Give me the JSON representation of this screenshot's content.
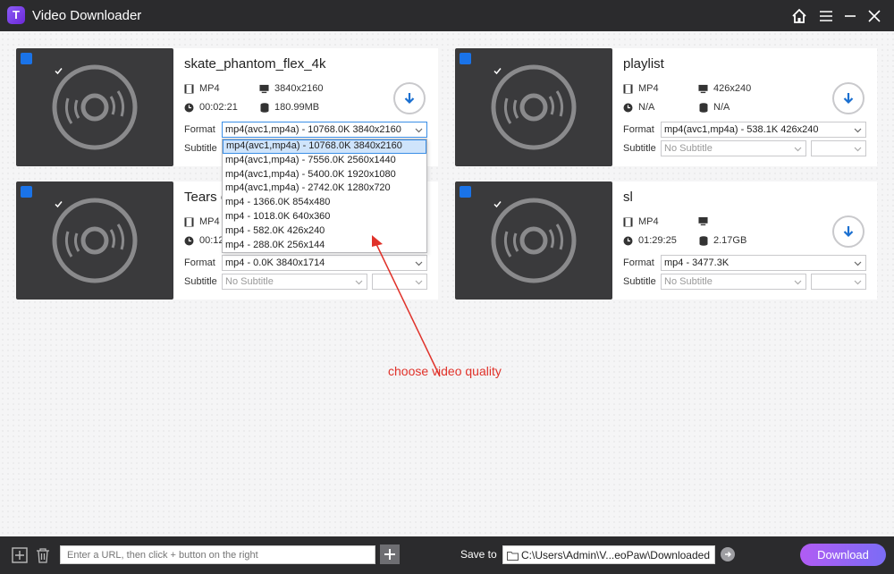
{
  "app": {
    "title": "Video Downloader",
    "logo_letter": "T"
  },
  "cards": [
    {
      "title": "skate_phantom_flex_4k",
      "container": "MP4",
      "resolution": "3840x2160",
      "duration": "00:02:21",
      "size": "180.99MB",
      "format_label": "Format",
      "format_value": "mp4(avc1,mp4a) - 10768.0K 3840x2160",
      "subtitle_label": "Subtitle",
      "subtitle_value": ""
    },
    {
      "title": "playlist",
      "container": "MP4",
      "resolution": "426x240",
      "duration": "N/A",
      "size": "N/A",
      "format_label": "Format",
      "format_value": "mp4(avc1,mp4a) - 538.1K 426x240",
      "subtitle_label": "Subtitle",
      "subtitle_value": "No Subtitle"
    },
    {
      "title": "Tears o",
      "container": "MP4",
      "resolution": "",
      "duration": "00:12",
      "size": "",
      "format_label": "Format",
      "format_value": "mp4 - 0.0K 3840x1714",
      "subtitle_label": "Subtitle",
      "subtitle_value": "No Subtitle"
    },
    {
      "title": "sl",
      "container": "MP4",
      "resolution": "",
      "duration": "01:29:25",
      "size": "2.17GB",
      "format_label": "Format",
      "format_value": "mp4 - 3477.3K",
      "subtitle_label": "Subtitle",
      "subtitle_value": "No Subtitle"
    }
  ],
  "dropdown": {
    "options": [
      "mp4(avc1,mp4a) - 10768.0K 3840x2160",
      "mp4(avc1,mp4a) - 7556.0K 2560x1440",
      "mp4(avc1,mp4a) - 5400.0K 1920x1080",
      "mp4(avc1,mp4a) - 2742.0K 1280x720",
      "mp4 - 1366.0K 854x480",
      "mp4 - 1018.0K 640x360",
      "mp4 - 582.0K 426x240",
      "mp4 - 288.0K 256x144"
    ],
    "selected_index": 0
  },
  "annotation": {
    "text": "choose video quality",
    "color": "#e0322a"
  },
  "bottom": {
    "url_placeholder": "Enter a URL, then click + button on the right",
    "save_label": "Save to",
    "save_path": "C:\\Users\\Admin\\V...eoPaw\\Downloaded",
    "download_label": "Download"
  },
  "colors": {
    "accent": "#1a73e8",
    "titlebar": "#2b2b2d",
    "download_gradient": [
      "#b15cf4",
      "#7b6cf5"
    ]
  }
}
